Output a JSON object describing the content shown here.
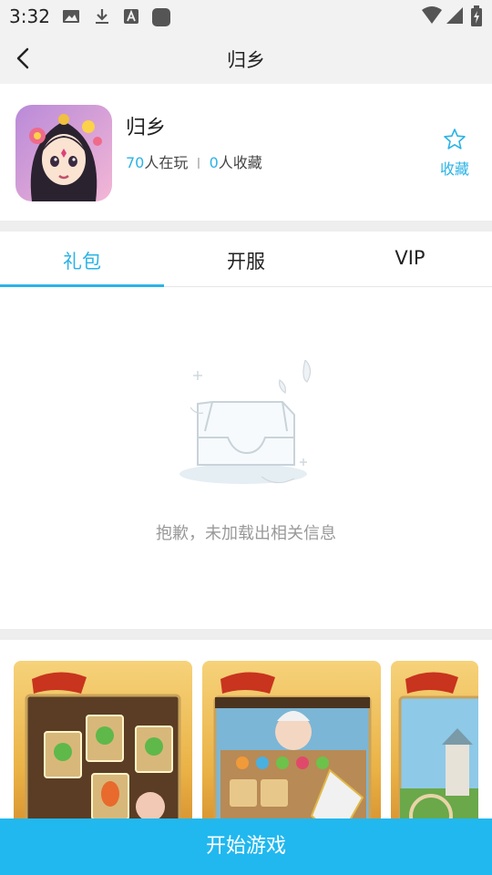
{
  "status_bar": {
    "time": "3:32"
  },
  "app_bar": {
    "title": "归乡"
  },
  "game": {
    "title": "归乡",
    "players": "70",
    "players_suffix": "人在玩",
    "separator": "丨",
    "favorites": "0",
    "favorites_suffix": "人收藏",
    "favorite_label": "收藏"
  },
  "tabs": [
    {
      "label": "礼包",
      "active": true
    },
    {
      "label": "开服",
      "active": false
    },
    {
      "label": "VIP",
      "active": false
    }
  ],
  "empty_state": {
    "message": "抱歉，未加载出相关信息"
  },
  "footer": {
    "start_label": "开始游戏"
  },
  "colors": {
    "accent": "#2bb3e6",
    "start_button": "#21b8ef"
  }
}
